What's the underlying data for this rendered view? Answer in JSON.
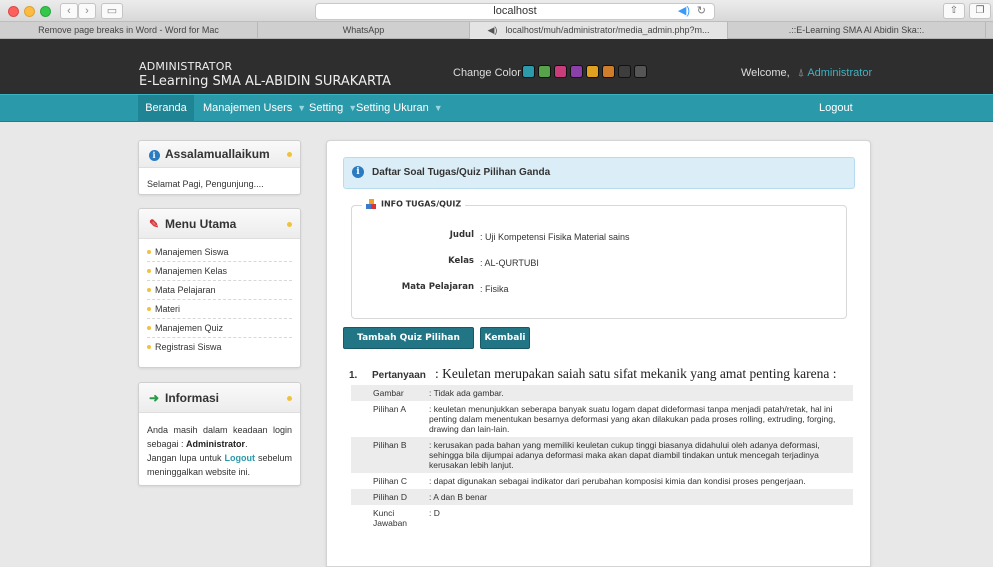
{
  "browser": {
    "address": "localhost",
    "tabs": [
      {
        "label": "Remove page breaks in Word - Word for Mac"
      },
      {
        "label": "WhatsApp"
      },
      {
        "label": "localhost/muh/administrator/media_admin.php?m..."
      },
      {
        "label": ".::E-Learning SMA Al Abidin Ska::."
      }
    ]
  },
  "header": {
    "role": "ADMINISTRATOR",
    "school": "E-Learning SMA AL-ABIDIN SURAKARTA",
    "change_color": "Change Color",
    "swatch_colors": [
      "#2c9aab",
      "#57a34a",
      "#c83d7a",
      "#8b3fa8",
      "#e0a020",
      "#cf7d2a",
      "#3d3d3d",
      "#555555"
    ],
    "welcome": "Welcome,",
    "user": "Administrator"
  },
  "nav": {
    "home": "Beranda",
    "users": "Manajemen Users",
    "setting": "Setting",
    "ukuran": "Setting Ukuran",
    "logout": "Logout"
  },
  "sidebar": {
    "greeting_title": "Assalamuallaikum",
    "greeting_text": "Selamat Pagi, Pengunjung....",
    "menu_title": "Menu Utama",
    "menu_items": [
      "Manajemen Siswa",
      "Manajemen Kelas",
      "Mata Pelajaran",
      "Materi",
      "Manajemen Quiz",
      "Registrasi Siswa"
    ],
    "info_title": "Informasi",
    "info_line1": "Anda masih dalam keadaan login sebagai :",
    "info_role": "Administrator",
    "info_line2a": "Jangan lupa untuk",
    "info_logout": "Logout",
    "info_line2b": "sebelum meninggalkan website ini."
  },
  "main": {
    "alert": "Daftar Soal Tugas/Quiz Pilihan Ganda",
    "legend": "INFO TUGAS/QUIZ",
    "info": [
      {
        "label": "Judul",
        "value": ": Uji Kompetensi Fisika Material sains"
      },
      {
        "label": "Kelas",
        "value": ": AL-QURTUBI"
      },
      {
        "label": "Mata Pelajaran",
        "value": ": Fisika"
      }
    ],
    "btn_add": "Tambah Quiz Pilihan ganda",
    "btn_back": "Kembali",
    "question": {
      "number": "1.",
      "label": "Pertanyaan",
      "text": ": Keuletan merupakan saiah satu sifat mekanik yang amat penting karena :",
      "rows": [
        {
          "k": "Gambar",
          "v": ": Tidak ada gambar."
        },
        {
          "k": "Pilihan A",
          "v": ": keuletan menunjukkan seberapa banyak suatu logam dapat dideformasi tanpa menjadi patah/retak, hal ini penting dalam menentukan besarnya deformasi yang akan dilakukan pada proses rolling, extruding, forging, drawing dan lain-lain."
        },
        {
          "k": "Pilihan B",
          "v": ": kerusakan pada bahan yang memiliki keuletan cukup tinggi biasanya didahului oleh adanya deformasi, sehingga bila dijumpai adanya deformasi maka akan dapat diambil tindakan untuk mencegah terjadinya kerusakan lebih lanjut."
        },
        {
          "k": "Pilihan C",
          "v": ": dapat digunakan sebagai indikator dari perubahan komposisi kimia dan kondisi proses pengerjaan."
        },
        {
          "k": "Pilihan D",
          "v": ": A dan B benar"
        },
        {
          "k": "Kunci Jawaban",
          "v": ": D"
        }
      ]
    }
  }
}
